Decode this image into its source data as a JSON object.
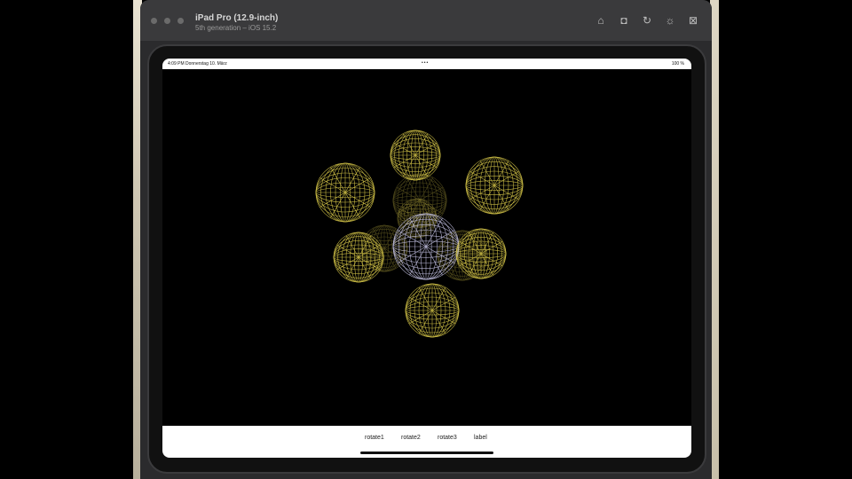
{
  "simulator": {
    "device_title": "iPad Pro (12.9-inch)",
    "device_subtitle": "5th generation – iOS 15.2",
    "toolbar_icons": [
      "home-icon",
      "screenshot-icon",
      "rotate-icon",
      "appearance-icon",
      "more-icon"
    ]
  },
  "statusbar": {
    "time": "4:09 PM  Donnerstag 10. März",
    "dots": "•••",
    "right": "100 %"
  },
  "scene": {
    "wire_color": "#d9c94a",
    "center_color": "#c8c6e8",
    "spheres": [
      {
        "id": "top"
      },
      {
        "id": "upper-left"
      },
      {
        "id": "upper-right"
      },
      {
        "id": "center"
      },
      {
        "id": "left"
      },
      {
        "id": "right"
      },
      {
        "id": "bottom"
      }
    ]
  },
  "toolbar": {
    "buttons": [
      "rotate1",
      "rotate2",
      "rotate3",
      "label"
    ]
  }
}
